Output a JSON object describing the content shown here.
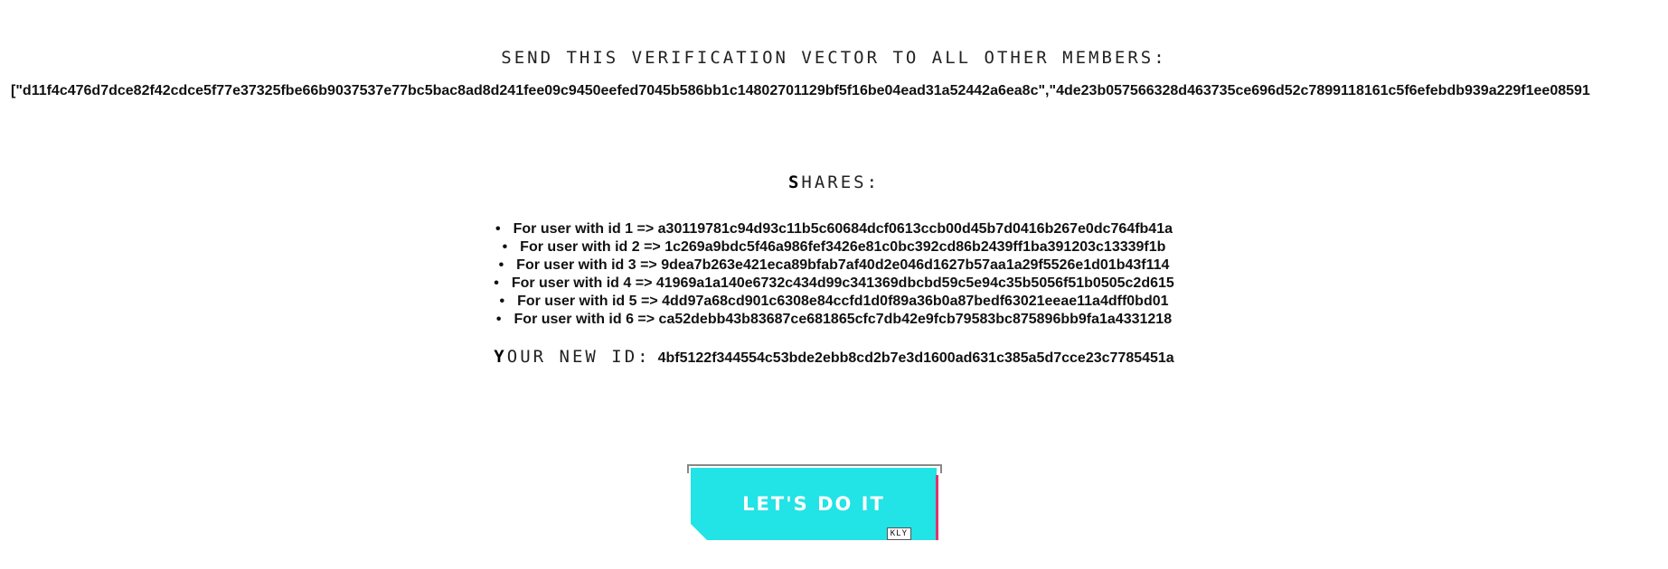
{
  "verification": {
    "heading": "SEND THIS VERIFICATION VECTOR TO ALL OTHER MEMBERS:",
    "vector_text": "[\"d11f4c476d7dce82f42cdce5f77e37325fbe66b9037537e77bc5bac8ad8d241fee09c9450eefed7045b586bb1c14802701129bf5f16be04ead31a52442a6ea8c\",\"4de23b057566328d463735ce696d52c7899118161c5f6efebdb939a229f1ee08591"
  },
  "shares": {
    "heading_first": "S",
    "heading_rest": "HARES:",
    "items": [
      {
        "label": "For user with id 1 => a30119781c94d93c11b5c60684dcf0613ccb00d45b7d0416b267e0dc764fb41a"
      },
      {
        "label": "For user with id 2 => 1c269a9bdc5f46a986fef3426e81c0bc392cd86b2439ff1ba391203c13339f1b"
      },
      {
        "label": "For user with id 3 => 9dea7b263e421eca89bfab7af40d2e046d1627b57aa1a29f5526e1d01b43f114"
      },
      {
        "label": "For user with id 4 => 41969a1a140e6732c434d99c341369dbcbd59c5e94c35b5056f51b0505c2d615"
      },
      {
        "label": "For user with id 5 => 4dd97a68cd901c6308e84ccfd1d0f89a36b0a87bedf63021eeae11a4dff0bd01"
      },
      {
        "label": "For user with id 6 => ca52debb43b83687ce681865cfc7db42e9fcb79583bc875896bb9fa1a4331218"
      }
    ]
  },
  "new_id": {
    "label_first": "Y",
    "label_rest": "OUR NEW ID:",
    "value": "4bf5122f344554c53bde2ebb8cd2b7e3d1600ad631c385a5d7cce23c7785451a"
  },
  "cta": {
    "label": "LET'S DO IT",
    "tag": "KLY"
  },
  "colors": {
    "button": "#22e3e6",
    "button_edge": "#e0336e",
    "text": "#111111"
  }
}
